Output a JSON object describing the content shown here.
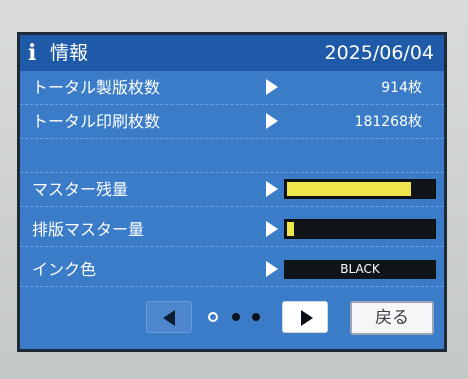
{
  "header": {
    "title": "情報",
    "date": "2025/06/04"
  },
  "rows": [
    {
      "label": "トータル製版枚数",
      "value": "914枚"
    },
    {
      "label": "トータル印刷枚数",
      "value": "181268枚"
    },
    {
      "label": ""
    },
    {
      "label": "マスター残量",
      "level": 0.85
    },
    {
      "label": "排版マスター量",
      "level": 0.05
    },
    {
      "label": "インク色",
      "value": "BLACK"
    }
  ],
  "nav": {
    "back_label": "戻る",
    "page_dots": 3,
    "active_dot": 0
  },
  "colors": {
    "screen_bg": "#3b7cc8",
    "header_bg": "#1f5aa8",
    "level_fill": "#eee64a"
  }
}
